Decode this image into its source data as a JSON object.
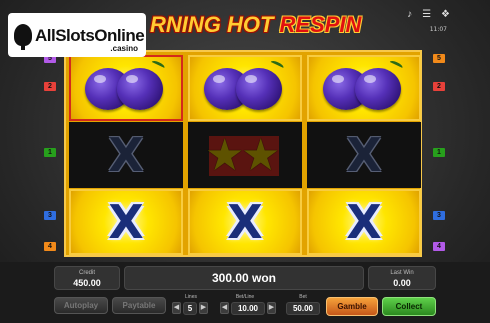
{
  "brand": {
    "name": "AllSlotsOnline",
    "suffix": ".casino"
  },
  "title": {
    "part1": "RNING HOT",
    "part2": "RESPIN"
  },
  "top_icons": [
    "music-note-icon",
    "settings-sliders-icon",
    "fullscreen-icon"
  ],
  "clock": "11:07",
  "reels": [
    [
      "plum",
      "x-dim",
      "x"
    ],
    [
      "plum",
      "stars",
      "x"
    ],
    [
      "plum",
      "x-dim",
      "x"
    ]
  ],
  "line_markers": {
    "left": [
      "5",
      "2",
      "1",
      "3",
      "4"
    ],
    "right": [
      "5",
      "2",
      "1",
      "3",
      "4"
    ]
  },
  "credit": {
    "label": "Credit",
    "value": "450.00"
  },
  "win": {
    "text": "300.00 won"
  },
  "last_win": {
    "label": "Last Win",
    "value": "0.00"
  },
  "autoplay_label": "Autoplay",
  "paytable_label": "Paytable",
  "lines": {
    "label": "Lines",
    "value": "5"
  },
  "bet_line": {
    "label": "Bet/Line",
    "value": "10.00"
  },
  "bet": {
    "label": "Bet",
    "value": "50.00"
  },
  "gamble_label": "Gamble",
  "collect_label": "Collect",
  "colors": {
    "reel_gold": "#e2a300",
    "win_outline": "#d42a1a",
    "gamble": "#e07a24",
    "collect": "#3fae2e"
  }
}
